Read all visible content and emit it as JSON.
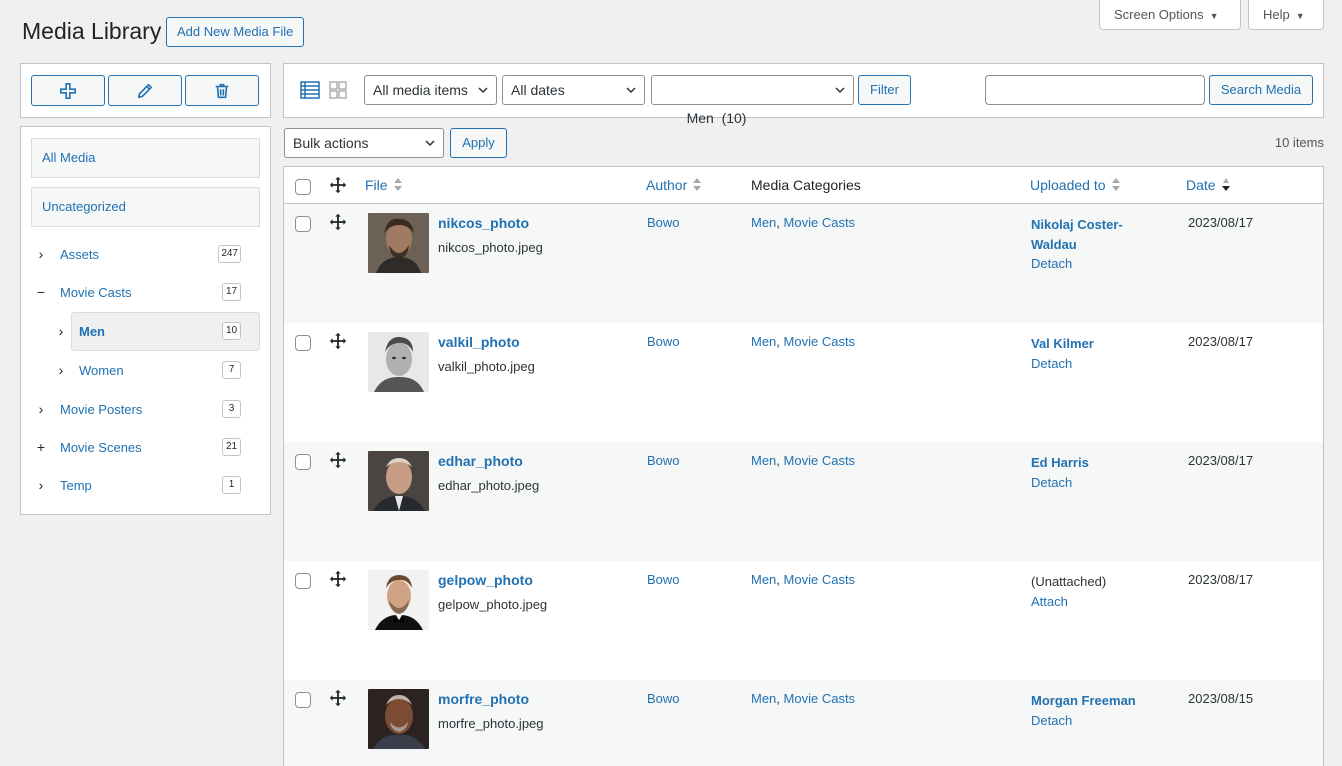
{
  "header": {
    "title": "Media Library",
    "add_new": "Add New Media File",
    "screen_options": "Screen Options",
    "help": "Help"
  },
  "sidebar": {
    "pills": [
      "All Media",
      "Uncategorized"
    ],
    "tree": [
      {
        "label": "Assets",
        "count": "247",
        "toggle": "expand"
      },
      {
        "label": "Movie Casts",
        "count": "17",
        "toggle": "collapse"
      },
      {
        "label": "Men",
        "count": "10",
        "toggle": "expand",
        "selected": true
      },
      {
        "label": "Women",
        "count": "7",
        "toggle": "expand"
      },
      {
        "label": "Movie Posters",
        "count": "3",
        "toggle": "expand"
      },
      {
        "label": "Movie Scenes",
        "count": "21",
        "toggle": "add"
      },
      {
        "label": "Temp",
        "count": "1",
        "toggle": "expand"
      }
    ]
  },
  "filters": {
    "media_type": "All media items",
    "dates": "All dates",
    "category": "Men  (10)",
    "filter_button": "Filter",
    "search_value": "",
    "search_button": "Search Media",
    "bulk_actions": "Bulk actions",
    "apply": "Apply",
    "items_count": "10 items"
  },
  "table": {
    "columns": {
      "file": "File",
      "author": "Author",
      "categories": "Media Categories",
      "uploaded_to": "Uploaded to",
      "date": "Date"
    },
    "rows": [
      {
        "title": "nikcos_photo",
        "file": "nikcos_photo.jpeg",
        "author": "Bowo",
        "cat1": "Men",
        "cat2": "Movie Casts",
        "parent": "Nikolaj Coster-Waldau",
        "action": "Detach",
        "date": "2023/08/17",
        "attached": true
      },
      {
        "title": "valkil_photo",
        "file": "valkil_photo.jpeg",
        "author": "Bowo",
        "cat1": "Men",
        "cat2": "Movie Casts",
        "parent": "Val Kilmer",
        "action": "Detach",
        "date": "2023/08/17",
        "attached": true
      },
      {
        "title": "edhar_photo",
        "file": "edhar_photo.jpeg",
        "author": "Bowo",
        "cat1": "Men",
        "cat2": "Movie Casts",
        "parent": "Ed Harris",
        "action": "Detach",
        "date": "2023/08/17",
        "attached": true
      },
      {
        "title": "gelpow_photo",
        "file": "gelpow_photo.jpeg",
        "author": "Bowo",
        "cat1": "Men",
        "cat2": "Movie Casts",
        "parent": "(Unattached)",
        "action": "Attach",
        "date": "2023/08/17",
        "attached": false
      },
      {
        "title": "morfre_photo",
        "file": "morfre_photo.jpeg",
        "author": "Bowo",
        "cat1": "Men",
        "cat2": "Movie Casts",
        "parent": "Morgan Freeman",
        "action": "Detach",
        "date": "2023/08/15",
        "attached": true
      }
    ]
  },
  "colors": {
    "accent": "#2271b1",
    "background": "#f0f0f1",
    "border": "#c3c4c7"
  },
  "icons": [
    "add-category-icon",
    "edit-pencil-icon",
    "trash-icon",
    "list-view-icon",
    "grid-view-icon",
    "move-handle-icon",
    "sort-arrows-icon",
    "chevron-down-icon"
  ]
}
